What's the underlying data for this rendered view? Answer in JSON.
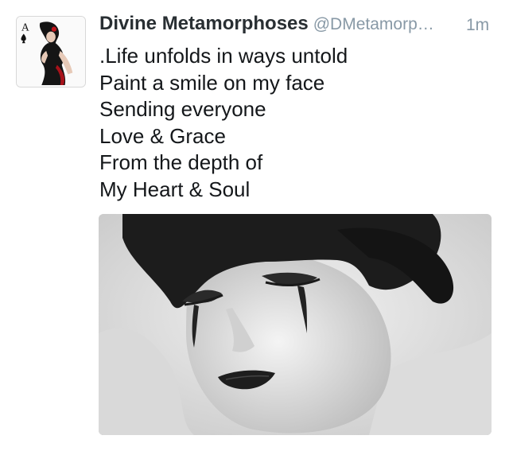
{
  "tweet": {
    "display_name": "Divine Metamorphoses",
    "handle": "@DMetamorp…",
    "timestamp": "1m",
    "lines": [
      ".Life unfolds in ways untold",
      "Paint a smile on my face",
      "Sending everyone",
      "Love & Grace",
      "From the depth of",
      "My Heart & Soul"
    ],
    "avatar": {
      "icon": "profile-avatar",
      "card_rank": "A"
    },
    "media": {
      "icon": "photo-monochrome-portrait"
    }
  },
  "colors": {
    "name": "#292f33",
    "secondary": "#8899a6",
    "text": "#14171a",
    "avatar_accent": "#c0141c"
  }
}
